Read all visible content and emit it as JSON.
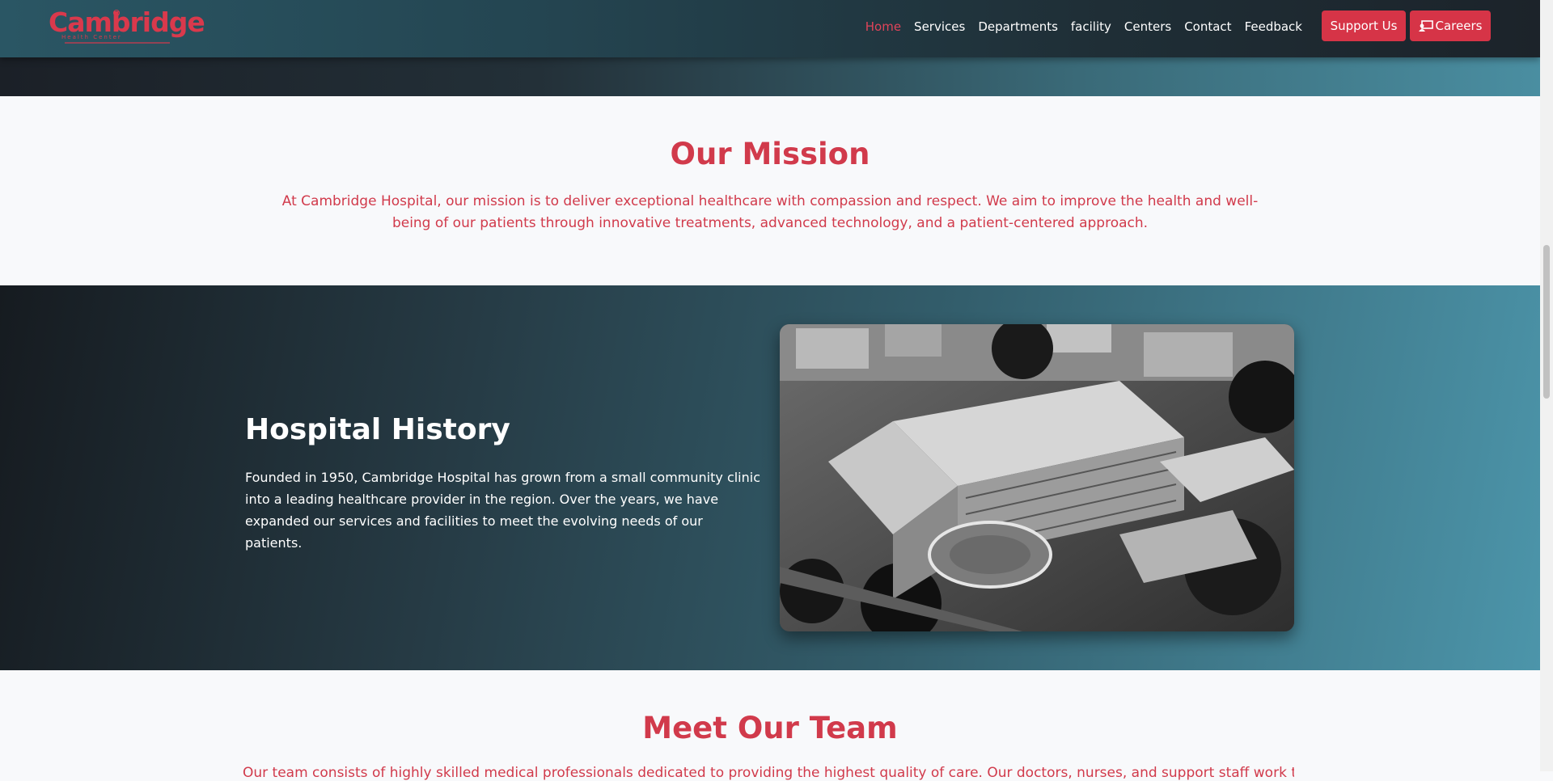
{
  "brand": {
    "name": "Cambridge",
    "tagline": "Health Center",
    "color": "#d9394c"
  },
  "nav": {
    "items": [
      {
        "label": "Home",
        "active": true
      },
      {
        "label": "Services"
      },
      {
        "label": "Departments"
      },
      {
        "label": "facility"
      },
      {
        "label": "Centers"
      },
      {
        "label": "Contact"
      },
      {
        "label": "Feedback"
      }
    ],
    "support_label": "Support Us",
    "careers_label": "Careers",
    "careers_icon": "chalkboard-user-icon"
  },
  "mission": {
    "title": "Our Mission",
    "text": "At Cambridge Hospital, our mission is to deliver exceptional healthcare with compassion and respect. We aim to improve the health and well-being of our patients through innovative treatments, advanced technology, and a patient-centered approach."
  },
  "history": {
    "title": "Hospital History",
    "text": "Founded in 1950, Cambridge Hospital has grown from a small community clinic into a leading healthcare provider in the region. Over the years, we have expanded our services and facilities to meet the evolving needs of our patients.",
    "image_alt": "Aerial black-and-white photo of the hospital"
  },
  "team": {
    "title": "Meet Our Team",
    "text_partial": "Our team consists of highly skilled medical professionals dedicated to providing the highest quality of care. Our doctors, nurses, and support staff work together"
  },
  "colors": {
    "accent": "#d13a4b",
    "button": "#d63447"
  }
}
